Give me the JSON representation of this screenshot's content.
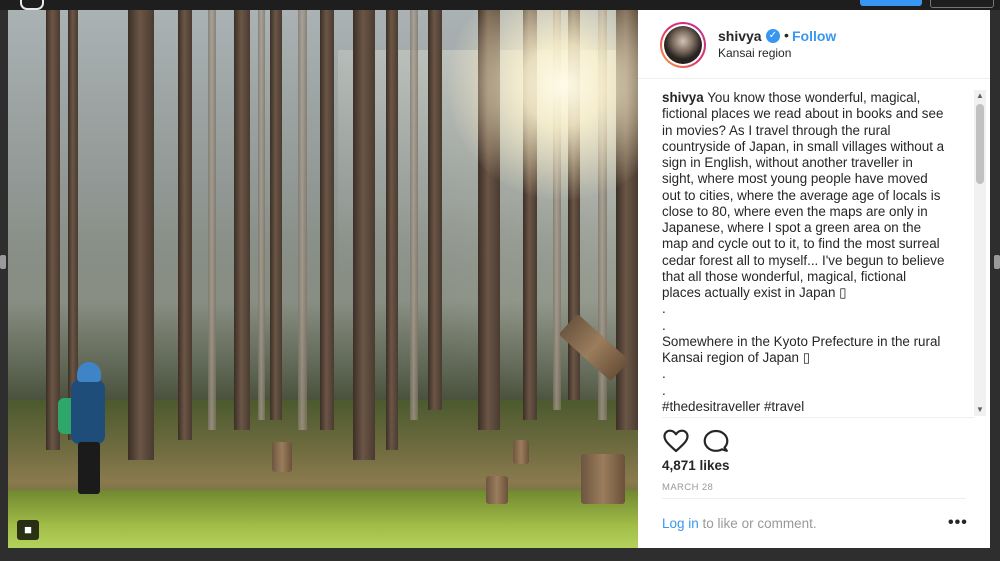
{
  "post": {
    "username": "shivya",
    "verified_icon": "verified-badge-icon",
    "separator": "•",
    "follow_label": "Follow",
    "location": "Kansai region",
    "caption_user": "shivya",
    "caption_text": "You know those wonderful, magical, fictional places we read about in books and see in movies? As I travel through the rural countryside of Japan, in small villages without a sign in English, without another traveller in sight, where most young people have moved out to cities, where the average age of locals is close to 80, where even the maps are only in Japanese, where I spot a green area on the map and cycle out to it, to find the most surreal cedar forest all to myself... I've begun to believe that all those wonderful, magical, fictional places actually exist in Japan ▯\n.\n.\nSomewhere in the Kyoto Prefecture in the rural Kansai region of Japan ▯\n.\n.\n#thedesitraveller #travel",
    "likes": "4,871 likes",
    "date": "MARCH 28",
    "login_link": "Log in",
    "login_rest": " to like or comment.",
    "more_label": "•••"
  },
  "photo": {
    "alt_subject": "cedar forest with hiker",
    "user_tag_icon": "user-tag-icon"
  },
  "colors": {
    "link_blue": "#3897f0",
    "text": "#262626",
    "muted": "#999999"
  }
}
